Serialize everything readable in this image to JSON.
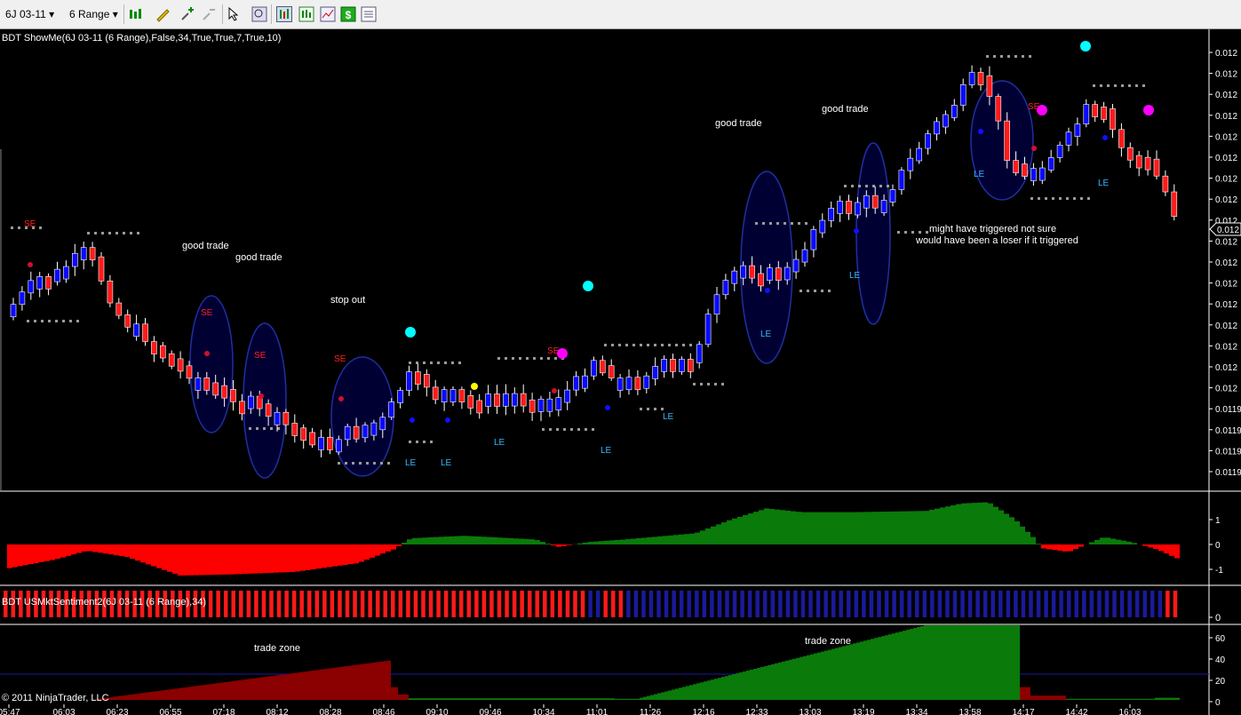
{
  "toolbar": {
    "instrument": "6J 03-11",
    "bar_type": "6 Range",
    "icons": [
      "bar-style-icon",
      "draw-pencil-icon",
      "zoom-in-icon",
      "zoom-out-icon",
      "cursor-icon",
      "magnify-icon",
      "chart-trader-icon",
      "data-box-icon",
      "performance-icon",
      "dollar-icon",
      "properties-icon"
    ]
  },
  "panels": {
    "price": {
      "indicator_label": "BDT ShowMe(6J 03-11 (6 Range),False,34,True,True,7,True,10)",
      "price_labels": [
        "0.012",
        "0.012",
        "0.012",
        "0.012",
        "0.012",
        "0.012",
        "0.012",
        "0.012",
        "0.012",
        "0.012",
        "0.012",
        "0.012",
        "0.012",
        "0.012",
        "0.012",
        "0.012",
        "0.012",
        "0.0119",
        "0.0119",
        "0.0119",
        "0.0119"
      ],
      "current_price_label": "0.012",
      "annotations": {
        "good_trade": "good trade",
        "stop_out": "stop out",
        "note_line1": "might have triggered not sure",
        "note_line2": "would have been a loser if it triggered",
        "se": "SE",
        "le": "LE"
      }
    },
    "oscillator": {
      "axis_labels": [
        "1",
        "0",
        "-1"
      ]
    },
    "sentiment": {
      "indicator_label": "BDT USMktSentiment2(6J 03-11 (6 Range),34)",
      "axis_label": "0"
    },
    "trade_zone": {
      "label": "trade zone",
      "axis_labels": [
        "60",
        "40",
        "20",
        "0"
      ],
      "copyright": "© 2011 NinjaTrader, LLC"
    }
  },
  "time_axis": [
    "05:47",
    "06:03",
    "06:23",
    "06:55",
    "07:18",
    "08:12",
    "08:28",
    "08:46",
    "09:10",
    "09:46",
    "10:34",
    "11:01",
    "11:26",
    "12:16",
    "12:33",
    "13:03",
    "13:19",
    "13:34",
    "13:58",
    "14:17",
    "14:42",
    "16:03"
  ],
  "colors": {
    "up_bar": "#0a0aff",
    "down_bar": "#ff1a1a",
    "osc_positive": "#0a7a0a",
    "osc_negative": "#ff0000",
    "tz_red": "#8b0000",
    "tz_green": "#0a7a0a",
    "cyan_dot": "#00ffff",
    "magenta_dot": "#ff00ff",
    "ellipse": "#000033",
    "le_text": "#33bbff",
    "se_text": "#ff2020"
  }
}
